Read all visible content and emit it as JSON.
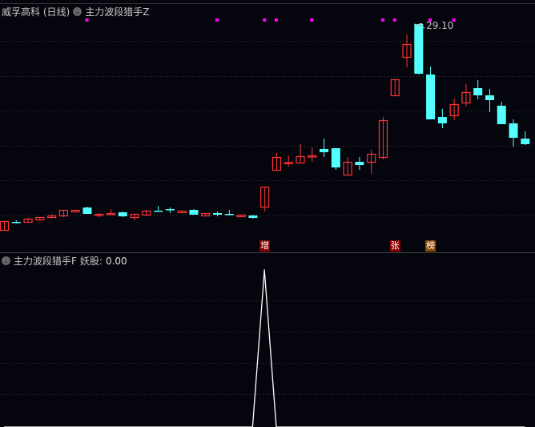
{
  "header": {
    "title": "威孚高科 (日线)",
    "indicator_main": "主力波段猎手Z",
    "indicator_sub": "主力波段猎手F",
    "sub_label": "妖股:",
    "sub_value": "0.00"
  },
  "colors": {
    "up": "#ff3333",
    "down": "#54ffff",
    "signal": "#ff00ff",
    "grid": "#3a3a3a",
    "line": "#ffffff",
    "mark_red": "#8b0000",
    "mark_orange": "#8b4a00"
  },
  "chart_data": [
    {
      "type": "candlestick",
      "title": "威孚高科 (日线)",
      "peak_label": "29.10",
      "ohlc": [
        [
          16.25,
          16.8,
          16.25,
          16.8
        ],
        [
          16.75,
          16.85,
          16.65,
          16.73
        ],
        [
          16.75,
          17.0,
          16.75,
          16.95
        ],
        [
          16.9,
          17.05,
          16.9,
          17.05
        ],
        [
          17.05,
          17.25,
          17.0,
          17.15
        ],
        [
          17.15,
          17.5,
          17.05,
          17.5
        ],
        [
          17.4,
          17.5,
          17.35,
          17.5
        ],
        [
          17.65,
          17.7,
          17.25,
          17.25
        ],
        [
          17.2,
          17.3,
          17.05,
          17.25
        ],
        [
          17.25,
          17.55,
          17.25,
          17.3
        ],
        [
          17.35,
          17.4,
          17.05,
          17.1
        ],
        [
          17.05,
          17.25,
          16.85,
          17.25
        ],
        [
          17.2,
          17.5,
          17.1,
          17.45
        ],
        [
          17.45,
          17.75,
          17.4,
          17.4
        ],
        [
          17.55,
          17.65,
          17.3,
          17.5
        ],
        [
          17.35,
          17.45,
          17.3,
          17.45
        ],
        [
          17.5,
          17.55,
          17.2,
          17.2
        ],
        [
          17.15,
          17.3,
          17.15,
          17.3
        ],
        [
          17.3,
          17.4,
          17.1,
          17.2
        ],
        [
          17.25,
          17.5,
          17.15,
          17.2
        ],
        [
          17.1,
          17.2,
          17.05,
          17.2
        ],
        [
          17.15,
          17.2,
          16.95,
          17.0
        ],
        [
          17.7,
          18.95,
          17.4,
          18.95
        ],
        [
          20.0,
          21.05,
          20.0,
          20.8
        ],
        [
          20.43,
          20.9,
          20.2,
          20.48
        ],
        [
          20.45,
          21.6,
          20.45,
          20.85
        ],
        [
          20.85,
          21.4,
          20.5,
          20.9
        ],
        [
          21.3,
          21.95,
          20.8,
          21.1
        ],
        [
          21.35,
          21.35,
          20.0,
          20.15
        ],
        [
          19.7,
          20.8,
          19.65,
          20.5
        ],
        [
          20.5,
          20.8,
          20.0,
          20.3
        ],
        [
          20.5,
          21.25,
          19.75,
          21.0
        ],
        [
          20.8,
          23.3,
          20.65,
          23.1
        ],
        [
          24.65,
          25.65,
          24.65,
          25.65
        ],
        [
          27.05,
          28.45,
          26.4,
          27.85
        ],
        [
          29.1,
          29.1,
          25.95,
          26.0
        ],
        [
          25.95,
          26.45,
          23.15,
          23.15
        ],
        [
          23.3,
          23.8,
          22.6,
          22.9
        ],
        [
          23.4,
          24.45,
          23.1,
          24.1
        ],
        [
          24.2,
          25.35,
          23.95,
          24.85
        ],
        [
          25.1,
          25.6,
          24.4,
          24.65
        ],
        [
          24.65,
          25.05,
          23.6,
          24.35
        ],
        [
          24.0,
          24.25,
          22.85,
          22.85
        ],
        [
          22.9,
          23.15,
          21.45,
          22.0
        ],
        [
          21.95,
          22.4,
          21.55,
          21.6
        ]
      ],
      "signal_dots": [
        7,
        18,
        22,
        23,
        26,
        32,
        33,
        36,
        38
      ],
      "markers": [
        {
          "index": 22,
          "text": "增",
          "style": "red"
        },
        {
          "index": 33,
          "text": "张",
          "style": "red"
        },
        {
          "index": 36,
          "text": "榜",
          "style": "orange"
        }
      ]
    },
    {
      "type": "line",
      "title": "主力波段猎手F",
      "series": [
        {
          "name": "妖股",
          "values": [
            0,
            0,
            0,
            0,
            0,
            0,
            0,
            0,
            0,
            0,
            0,
            0,
            0,
            0,
            0,
            0,
            0,
            0,
            0,
            0,
            0,
            0,
            100,
            0,
            0,
            0,
            0,
            0,
            0,
            0,
            0,
            0,
            0,
            0,
            0,
            0,
            0,
            0,
            0,
            0,
            0,
            0,
            0,
            0,
            0
          ]
        }
      ],
      "ylim": [
        0,
        100
      ]
    }
  ]
}
